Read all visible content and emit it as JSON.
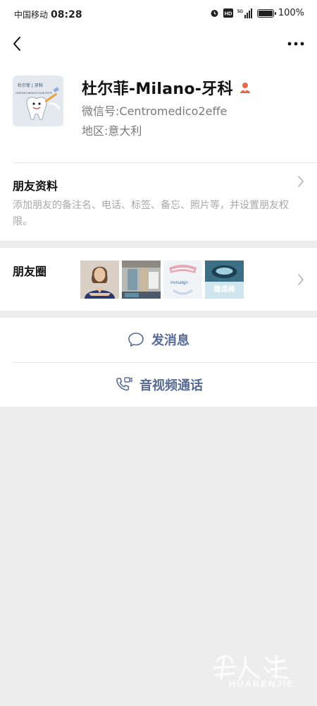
{
  "status_bar": {
    "carrier": "中国移动",
    "time": "08:28",
    "hd": "HD",
    "network": "5G",
    "battery_percent": "100%",
    "battery_level": 1.0
  },
  "nav": {
    "back_icon": "chevron-left-icon",
    "more_icon": "more-dots-icon"
  },
  "profile": {
    "name": "杜尔菲-Milano-牙科",
    "wechat_id_label": "微信号:",
    "wechat_id": "Centromedico2effe",
    "region_label": "地区:",
    "region": "意大利",
    "avatar_text_top": "杜尔菲 | 牙科",
    "avatar_text_sub": "CENTRO MEDICO DUE EFFE"
  },
  "friend_info": {
    "title": "朋友资料",
    "description": "添加朋友的备注名、电话、标签、备忘、照片等，并设置朋友权限。"
  },
  "moments": {
    "title": "朋友圈",
    "thumb_captions": [
      "invisalign",
      "隐适美"
    ]
  },
  "actions": {
    "message": "发消息",
    "call": "音视频通话"
  },
  "watermark": {
    "text": "HUARENJIE"
  },
  "colors": {
    "link_blue": "#576b95",
    "bg_gray": "#ededed",
    "badge_orange": "#e06a4a"
  }
}
